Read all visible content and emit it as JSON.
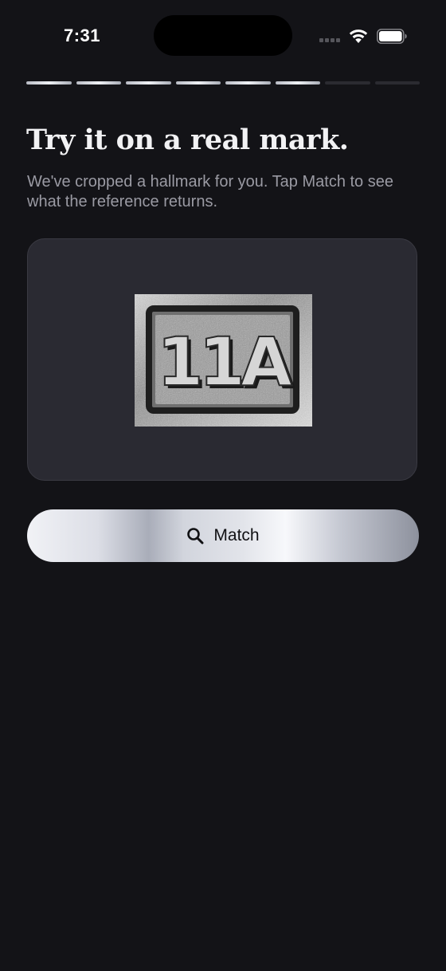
{
  "status_bar": {
    "time": "7:31",
    "signal_icon": "cellular-signal-icon",
    "wifi_icon": "wifi-icon",
    "battery_icon": "battery-icon"
  },
  "progress": {
    "total_steps": 8,
    "completed_steps": 6
  },
  "main": {
    "title": "Try it on a real mark.",
    "subtitle": "We've cropped a hallmark for you. Tap Match to see what the reference returns.",
    "sample_image": {
      "description_icon": "hallmark-photo",
      "mark_text": "11A"
    },
    "match_button": {
      "label": "Match",
      "icon": "search-icon"
    }
  },
  "colors": {
    "background": "#131317",
    "card": "#2a2a32",
    "title": "#f2f2f4",
    "subtitle": "#9a9aa3",
    "button_text": "#111114"
  }
}
